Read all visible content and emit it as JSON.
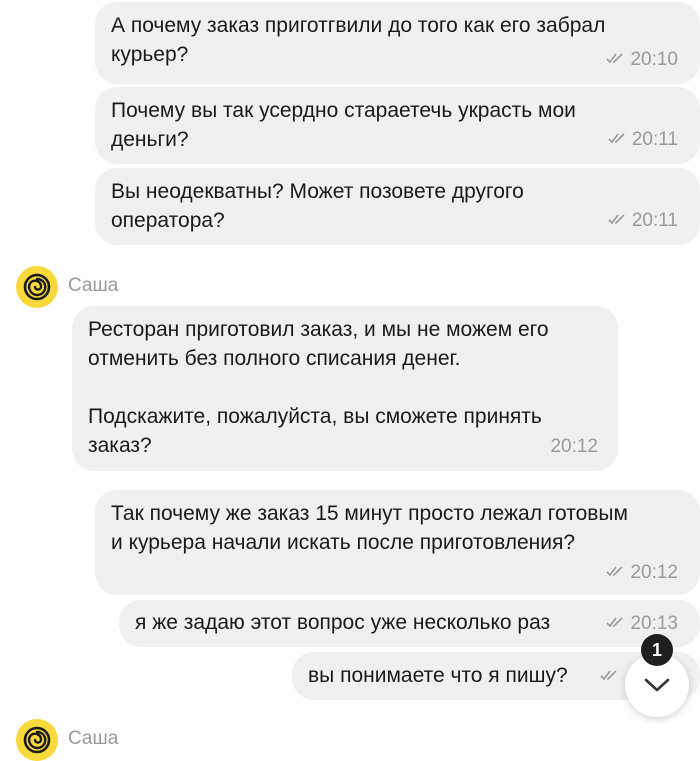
{
  "messages": [
    {
      "text": "А почему заказ приготгвили до того как его забрал\nкурьер?",
      "time": "20:10"
    },
    {
      "text": "Почему вы так усердно стараетечь украсть мои\nденьги?",
      "time": "20:11"
    },
    {
      "text": "Вы неодекватны? Может позовете другого\nоператора?",
      "time": "20:11"
    },
    {
      "text": "Ресторан приготовил заказ, и мы не можем его\nотменить без полного списания денег.\n\nПодскажите, пожалуйста, вы сможете принять\nзаказ?",
      "time": "20:12"
    },
    {
      "text": "Так почему же заказ 15 минут просто лежал готовым\nи курьера начали искать после приготовления?",
      "time": "20:12"
    },
    {
      "text": "я же задаю этот вопрос уже несколько раз",
      "time": "20:13"
    },
    {
      "text": "вы понимаете что я пишу?",
      "time": ""
    }
  ],
  "operator": {
    "name": "Саша",
    "name_partial": "Саша"
  },
  "scroll_button": {
    "icon": "chevron-down-icon",
    "unread_count": "1"
  },
  "colors": {
    "bubble": "#f0f0f0",
    "avatar": "#f8d93b",
    "meta": "#9a9a9a"
  }
}
